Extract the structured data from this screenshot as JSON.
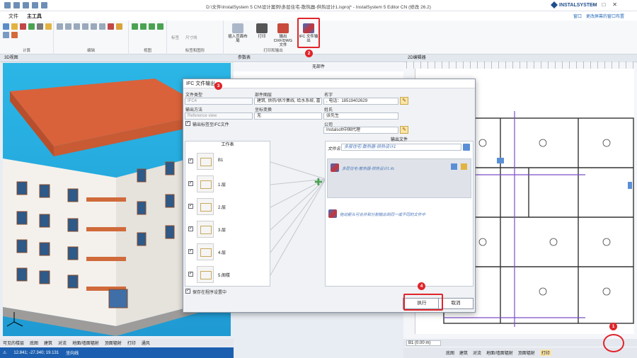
{
  "window": {
    "title": "D:\\文件\\InstalSystem 5 CN\\设计案例\\多层住宅-散热器-供热设计1.isproj* - InstalSystem 5 Editor CN (修改 26.2)",
    "logo": "INSTALSYSTEM"
  },
  "menu": {
    "tabs": [
      "文件",
      "主工具"
    ],
    "right_items": [
      "窗口",
      "更改屏幕的窗口布置"
    ]
  },
  "ribbon": {
    "groups": [
      "计算",
      "编辑",
      "视图",
      "标签和图形",
      "打印和输出"
    ],
    "buttons": {
      "insert_layout": "插入页面布局",
      "print": "打印",
      "export_dxf": "输出 DXF/DWG 文件",
      "ifc_export": "IFC 文件输出"
    },
    "mini_labels": [
      "标签",
      "尺寸线"
    ]
  },
  "panels": {
    "view3d": "3D视图",
    "params": "参数表",
    "params_sub": "无部件",
    "view2d": "2D编辑器"
  },
  "dialog": {
    "title": "IFC 文件输出",
    "file_type_label": "文件类型",
    "file_type_value": "IFC4",
    "layers_label": "部件图层",
    "layers_value": "建筑, 供热/供冷集线, 给水系统, 富",
    "name_label": "名字",
    "name_value": ", 电话：18519402629",
    "export_method_label": "输出方法",
    "export_method_value": "Reference view",
    "coord_label": "坐标变换",
    "coord_value": "无",
    "surname_label": "姓氏",
    "surname_value": "张先生",
    "company_label": "公司",
    "company_value": "Instalsoft中国代理",
    "export_labels_check": "输出标签至IFC文件",
    "worksheet_header": "工作表",
    "output_header": "输出文件",
    "file_name_label": "文件名",
    "file_name_value": "多层住宅-散热器-供热设计1",
    "output_item": "多层住宅-散热器-供热设计1.ifc",
    "hint_text": "拖动箭头可合并和分割输出到同一或不同的文件中",
    "save_settings": "保存在程序设置中",
    "run_button": "执行",
    "cancel_button": "取消",
    "worksheets": [
      "B1",
      "1.层",
      "2.层",
      "3.层",
      "4.层",
      "5.阁楼"
    ]
  },
  "status_left": {
    "layers_label": "可见的楼层",
    "tabs": [
      "底图",
      "建筑",
      "对流",
      "地面/墙面辐射",
      "顶面辐射",
      "打印",
      "通风"
    ],
    "coords": "12.841; -27.340; 19.131",
    "mode": "坐向线"
  },
  "status_right": {
    "floor": "B1 (0.00 m)",
    "tabs": [
      "底图",
      "建筑",
      "对流",
      "地面/墙面辐射",
      "顶面辐射",
      "打印"
    ]
  },
  "annotations": [
    "1",
    "2",
    "3",
    "4"
  ],
  "colors": {
    "accent": "#2a6bb8",
    "sky": "#1f9ad3",
    "roof": "#d9623a",
    "highlight": "#e0252b"
  }
}
